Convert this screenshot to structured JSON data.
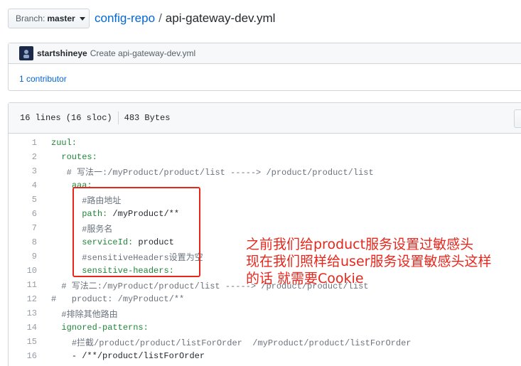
{
  "branch": {
    "label": "Branch:",
    "value": "master"
  },
  "breadcrumb": {
    "repo": "config-repo",
    "separator": "/",
    "file": "api-gateway-dev.yml"
  },
  "commit": {
    "author": "startshineye",
    "message": "Create api-gateway-dev.yml",
    "contributors": "1 contributor"
  },
  "file_info": {
    "lines": "16 lines (16 sloc)",
    "size": "483 Bytes"
  },
  "code_lines": [
    {
      "num": "1",
      "indent": "",
      "key": "zuul:",
      "rest": "",
      "comment": ""
    },
    {
      "num": "2",
      "indent": "  ",
      "key": "routes:",
      "rest": "",
      "comment": ""
    },
    {
      "num": "3",
      "indent": "   ",
      "key": "",
      "rest": "",
      "comment": "# 写法一:/myProduct/product/list -----> /product/product/list"
    },
    {
      "num": "4",
      "indent": "    ",
      "key": "aaa:",
      "rest": "",
      "comment": ""
    },
    {
      "num": "5",
      "indent": "      ",
      "key": "",
      "rest": "",
      "comment": "#路由地址"
    },
    {
      "num": "6",
      "indent": "      ",
      "key": "path:",
      "rest": " /myProduct/**",
      "comment": ""
    },
    {
      "num": "7",
      "indent": "      ",
      "key": "",
      "rest": "",
      "comment": "#服务名"
    },
    {
      "num": "8",
      "indent": "      ",
      "key": "serviceId:",
      "rest": " product",
      "comment": ""
    },
    {
      "num": "9",
      "indent": "      ",
      "key": "",
      "rest": "",
      "comment": "#sensitiveHeaders设置为空"
    },
    {
      "num": "10",
      "indent": "      ",
      "key": "sensitive-headers:",
      "rest": "",
      "comment": ""
    },
    {
      "num": "11",
      "indent": "  ",
      "key": "",
      "rest": "",
      "comment": "# 写法二:/myProduct/product/list -----> /product/product/list"
    },
    {
      "num": "12",
      "indent": "",
      "key": "",
      "rest": "",
      "comment": "#   product: /myProduct/**"
    },
    {
      "num": "13",
      "indent": "  ",
      "key": "",
      "rest": "",
      "comment": "#排除其他路由"
    },
    {
      "num": "14",
      "indent": "  ",
      "key": "ignored-patterns:",
      "rest": "",
      "comment": ""
    },
    {
      "num": "15",
      "indent": "    ",
      "key": "",
      "rest": "",
      "comment": "#拦截/product/product/listForOrder  /myProduct/product/listForOrder"
    },
    {
      "num": "16",
      "indent": "    ",
      "key": "",
      "rest": "- /**/product/listForOrder",
      "comment": ""
    }
  ],
  "annotation": {
    "line1": "之前我们给product服务设置过敏感头",
    "line2": "现在我们照样给user服务设置敏感头这样",
    "line3": "的话 就需要Cookie",
    "color": "#e8261c"
  }
}
